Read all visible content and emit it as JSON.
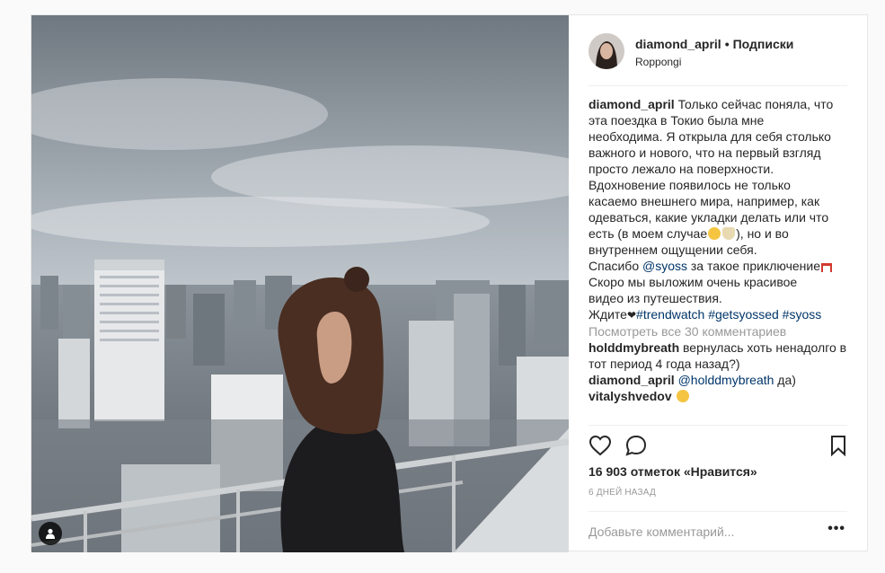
{
  "post": {
    "username": "diamond_april",
    "separator": "•",
    "follow_label": "Подписки",
    "location": "Roppongi",
    "caption_lines": [
      "Только сейчас поняла, что",
      "эта поездка в Токио была мне",
      "необходима. Я открыла для себя столько",
      "важного и нового, что на первый взгляд",
      "просто лежало на поверхности.",
      "Вдохновение появилось не только",
      "касаемо внешнего мира, например, как",
      "одеваться, какие укладки делать или что",
      "есть (в моем случае",
      "), но и во",
      "внутреннем ощущении себя.",
      "Спасибо",
      "@syoss",
      "за такое приключение",
      "Скоро мы выложим очень красивое",
      "видео из путешествия.",
      "Ждите",
      "#trendwatch #getsyossed #syoss"
    ],
    "view_all_comments": "Посмотреть все 30 комментариев",
    "comments": [
      {
        "user": "holddmybreath",
        "text": "вернулась хоть ненадолго в тот период 4 года назад?)"
      },
      {
        "user": "diamond_april",
        "mention": "@holddmybreath",
        "text": "да)"
      },
      {
        "user": "vitalyshvedov",
        "text": ""
      }
    ],
    "likes": "16 903 отметок «Нравится»",
    "time_ago": "6 дней назад",
    "add_comment_placeholder": "Добавьте комментарий...",
    "more_options": "•••"
  },
  "icons": {
    "like": "heart-icon",
    "comment": "comment-icon",
    "save": "bookmark-icon",
    "user_tag": "user-tag-icon"
  },
  "colors": {
    "link": "#003569",
    "muted": "#999999",
    "text": "#262626"
  }
}
